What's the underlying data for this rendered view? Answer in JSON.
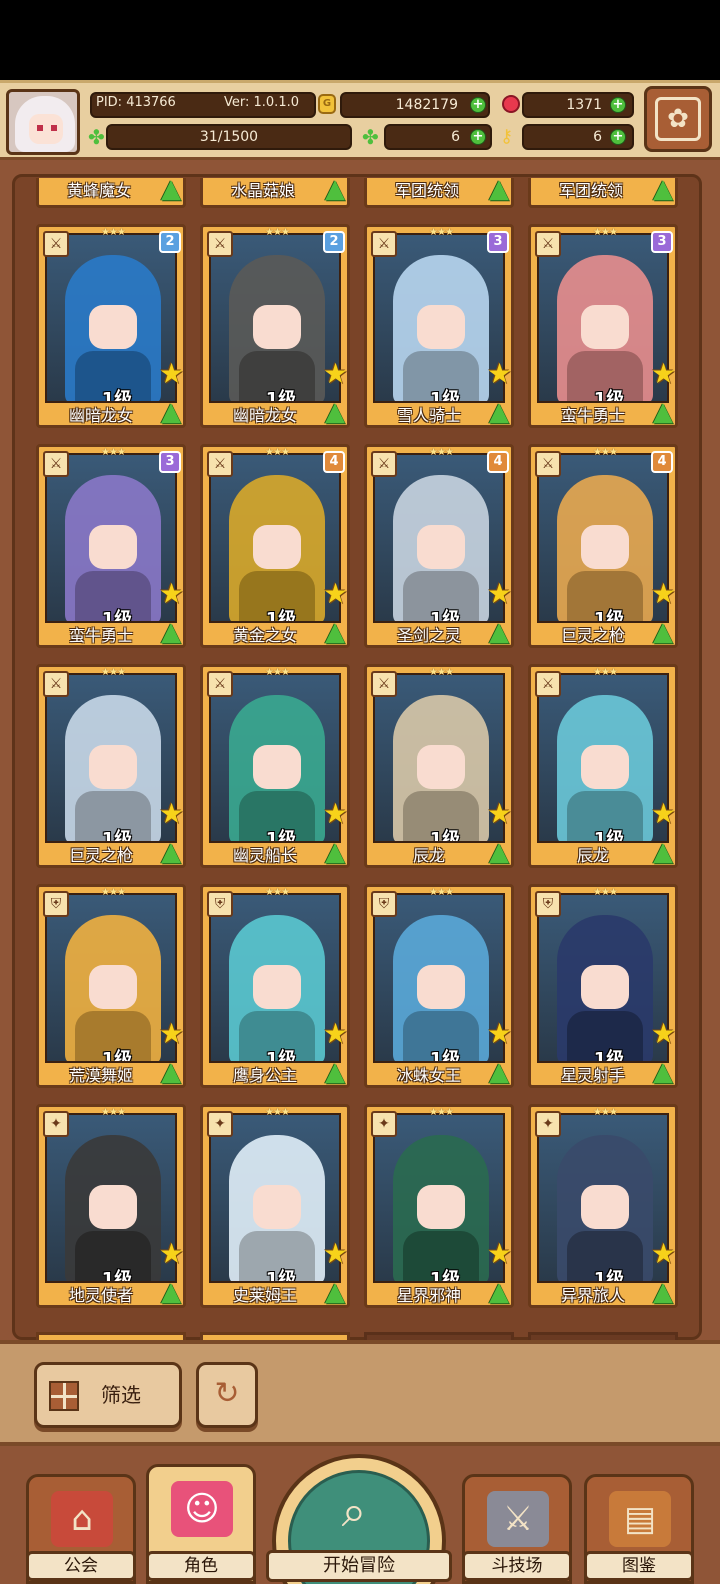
{
  "header": {
    "pid": "PID: 413766",
    "version": "Ver: 1.0.1.0",
    "gold": "1482179",
    "gems": "1371",
    "energy": "31/1500",
    "clover_count": "6",
    "key_count": "6"
  },
  "colors": {
    "accent": "#a85e35",
    "card_gold": "#f2b24a",
    "panel": "#7a4428",
    "plus_green": "#4fbf3d"
  },
  "top_row_names": [
    "黄蜂魔女",
    "水晶菇娘",
    "军团统领",
    "军团统领"
  ],
  "cards": [
    {
      "name": "幽暗龙女",
      "level": "1级",
      "rank": "2",
      "rank_color": "#5aa0e0",
      "weapon": "sword-icon",
      "hue": "#2a7ac8"
    },
    {
      "name": "幽暗龙女",
      "level": "1级",
      "rank": "2",
      "rank_color": "#5aa0e0",
      "weapon": "sword-icon",
      "hue": "#5a5a58"
    },
    {
      "name": "雪人骑士",
      "level": "1级",
      "rank": "3",
      "rank_color": "#9a6ad8",
      "weapon": "sword-icon",
      "hue": "#b8d6ef"
    },
    {
      "name": "蛮牛勇士",
      "level": "1级",
      "rank": "3",
      "rank_color": "#9a6ad8",
      "weapon": "sword-icon",
      "hue": "#e88e8e"
    },
    {
      "name": "蛮牛勇士",
      "level": "1级",
      "rank": "3",
      "rank_color": "#9a6ad8",
      "weapon": "sword-icon",
      "hue": "#8a78c8"
    },
    {
      "name": "黄金之女",
      "level": "1级",
      "rank": "4",
      "rank_color": "#e08a3a",
      "weapon": "sword-icon",
      "hue": "#d8a82a"
    },
    {
      "name": "圣剑之灵",
      "level": "1级",
      "rank": "4",
      "rank_color": "#e08a3a",
      "weapon": "sword-icon",
      "hue": "#c8d4e0"
    },
    {
      "name": "巨灵之枪",
      "level": "1级",
      "rank": "4",
      "rank_color": "#e08a3a",
      "weapon": "sword-icon",
      "hue": "#e8a850"
    },
    {
      "name": "巨灵之枪",
      "level": "1级",
      "rank": "",
      "rank_color": "",
      "weapon": "sword-icon",
      "hue": "#c8d8e8"
    },
    {
      "name": "幽灵船长",
      "level": "1级",
      "rank": "",
      "rank_color": "",
      "weapon": "sword-icon",
      "hue": "#3aa890"
    },
    {
      "name": "辰龙",
      "level": "1级",
      "rank": "",
      "rank_color": "",
      "weapon": "sword-icon",
      "hue": "#d8c8a8"
    },
    {
      "name": "辰龙",
      "level": "1级",
      "rank": "",
      "rank_color": "",
      "weapon": "sword-icon",
      "hue": "#6ac8d8"
    },
    {
      "name": "荒漠舞姬",
      "level": "1级",
      "rank": "",
      "rank_color": "",
      "weapon": "shield-icon",
      "hue": "#f0b040"
    },
    {
      "name": "鹰身公主",
      "level": "1级",
      "rank": "",
      "rank_color": "",
      "weapon": "shield-icon",
      "hue": "#5ac8d0"
    },
    {
      "name": "冰蛛女王",
      "level": "1级",
      "rank": "",
      "rank_color": "",
      "weapon": "shield-icon",
      "hue": "#5aa8d8"
    },
    {
      "name": "星灵射手",
      "level": "1级",
      "rank": "",
      "rank_color": "",
      "weapon": "shield-icon",
      "hue": "#2a3a6a"
    },
    {
      "name": "地灵使者",
      "level": "1级",
      "rank": "",
      "rank_color": "",
      "weapon": "wand-icon",
      "hue": "#3a3a3a"
    },
    {
      "name": "史莱姆王",
      "level": "1级",
      "rank": "",
      "rank_color": "",
      "weapon": "wand-icon",
      "hue": "#e0eef8"
    },
    {
      "name": "星界邪神",
      "level": "1级",
      "rank": "",
      "rank_color": "",
      "weapon": "wand-icon",
      "hue": "#2a6a50"
    },
    {
      "name": "异界旅人",
      "level": "1级",
      "rank": "",
      "rank_color": "",
      "weapon": "wand-icon",
      "hue": "#3a4a6a"
    }
  ],
  "filter": {
    "label": "筛选"
  },
  "nav": {
    "guild": "公会",
    "character": "角色",
    "start": "开始冒险",
    "arena": "斗技场",
    "codex": "图鉴"
  }
}
